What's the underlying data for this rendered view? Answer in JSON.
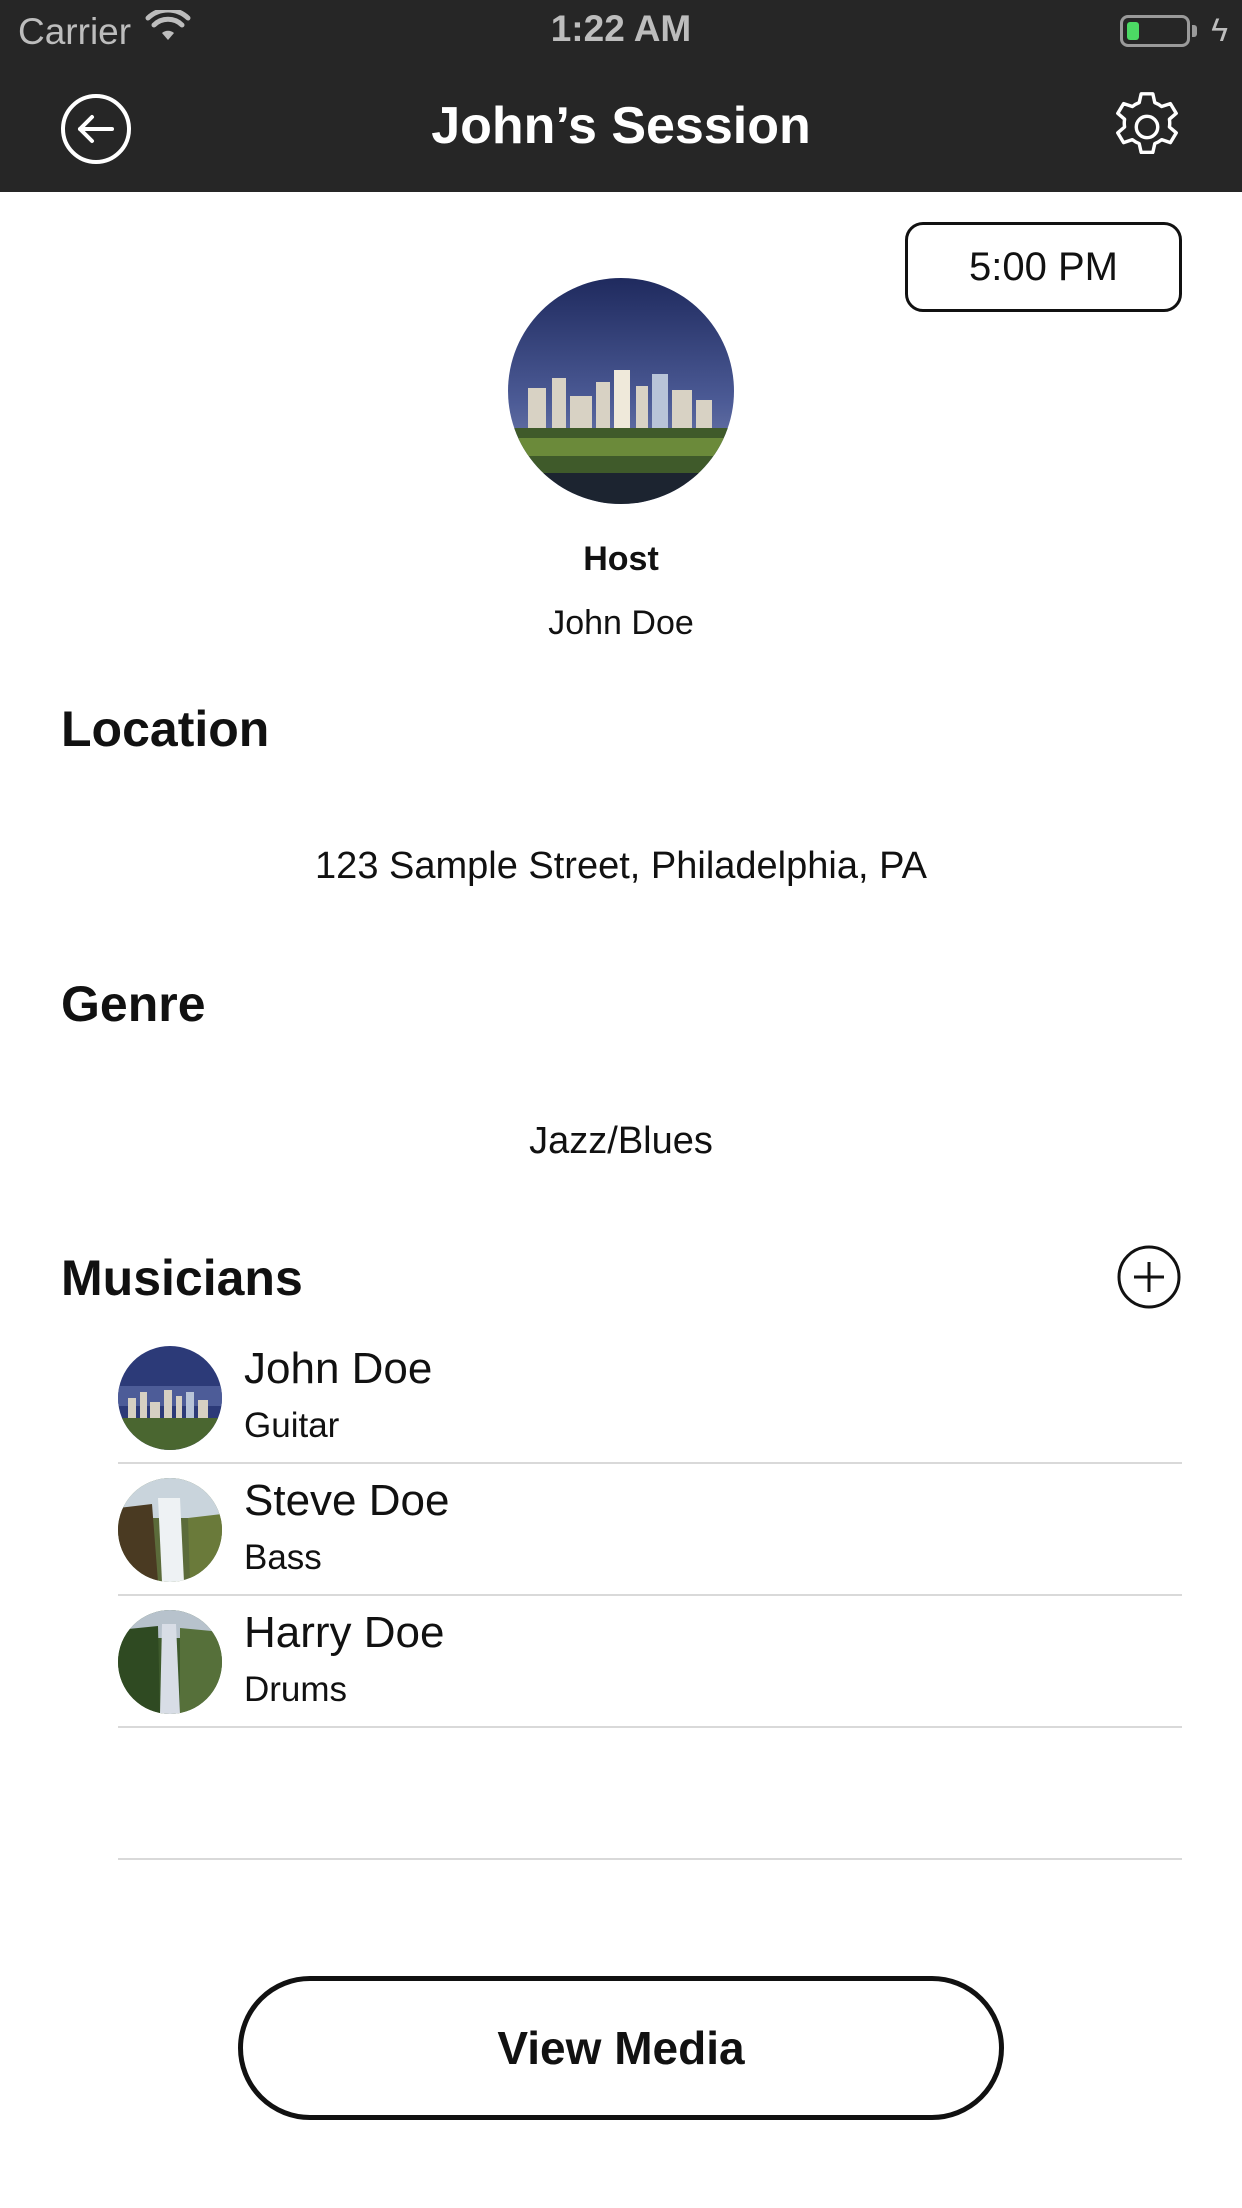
{
  "status_bar": {
    "carrier": "Carrier",
    "time": "1:22 AM",
    "battery_level": 0.2,
    "battery_color": "#4cd964",
    "charging_icon": "bolt-icon",
    "wifi_icon": "wifi-icon"
  },
  "nav": {
    "title": "John’s Session",
    "back_icon": "back-arrow-circle-icon",
    "settings_icon": "gear-icon"
  },
  "session": {
    "time": "5:00 PM",
    "host_label": "Host",
    "host_name": "John Doe",
    "host_avatar": "city-skyline-photo"
  },
  "location": {
    "heading": "Location",
    "value": "123 Sample Street, Philadelphia, PA"
  },
  "genre": {
    "heading": "Genre",
    "value": "Jazz/Blues"
  },
  "musicians": {
    "heading": "Musicians",
    "add_icon": "plus-circle-icon",
    "items": [
      {
        "name": "John Doe",
        "instrument": "Guitar",
        "avatar": "city-skyline-photo"
      },
      {
        "name": "Steve Doe",
        "instrument": "Bass",
        "avatar": "waterfall-cliff-photo"
      },
      {
        "name": "Harry Doe",
        "instrument": "Drums",
        "avatar": "waterfall-valley-photo"
      }
    ]
  },
  "actions": {
    "view_media_label": "View Media"
  },
  "colors": {
    "topbar": "#262626",
    "text": "#111111",
    "divider": "#d9d9d9"
  }
}
